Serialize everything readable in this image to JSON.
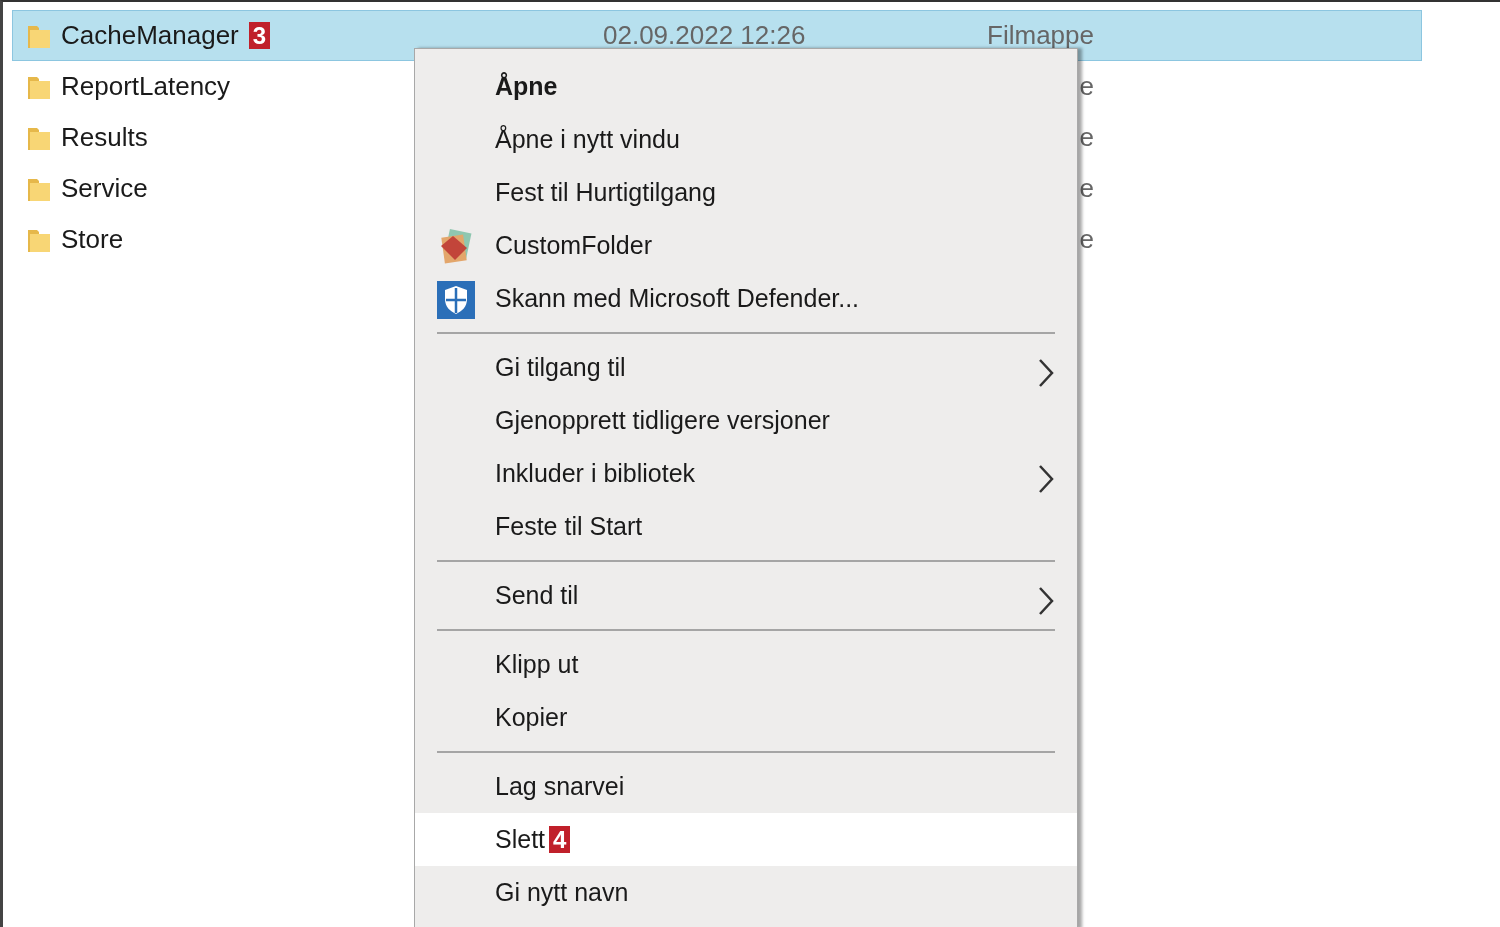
{
  "files": [
    {
      "name": "CacheManager",
      "badge": "3",
      "date": "02.09.2022 12:26",
      "type": "Filmappe",
      "selected": true
    },
    {
      "name": "ReportLatency",
      "type": "e",
      "selected": false
    },
    {
      "name": "Results",
      "type": "e",
      "selected": false
    },
    {
      "name": "Service",
      "type": "e",
      "selected": false
    },
    {
      "name": "Store",
      "type": "e",
      "selected": false
    }
  ],
  "context_menu": [
    {
      "kind": "item",
      "label": "Åpne",
      "bold": true,
      "selected": false
    },
    {
      "kind": "item",
      "label": "Åpne i nytt vindu",
      "selected": false
    },
    {
      "kind": "item",
      "label": "Fest til Hurtigtilgang",
      "selected": false
    },
    {
      "kind": "icon_item",
      "label": "CustomFolder",
      "selected": false
    },
    {
      "kind": "icon_item",
      "label": "Skann med Microsoft Defender...",
      "selected": false
    },
    {
      "kind": "separator"
    },
    {
      "kind": "item",
      "label": "Gi tilgang til",
      "submenu": true,
      "selected": false
    },
    {
      "kind": "item",
      "label": "Gjenopprett tidligere versjoner",
      "selected": false
    },
    {
      "kind": "item",
      "label": "Inkluder i bibliotek",
      "submenu": true,
      "selected": false
    },
    {
      "kind": "item",
      "label": "Feste til Start",
      "selected": false
    },
    {
      "kind": "separator"
    },
    {
      "kind": "item",
      "label": "Send til",
      "submenu": true,
      "selected": false
    },
    {
      "kind": "separator"
    },
    {
      "kind": "item",
      "label": "Klipp ut",
      "selected": false
    },
    {
      "kind": "item",
      "label": "Kopier",
      "selected": false
    },
    {
      "kind": "separator"
    },
    {
      "kind": "item",
      "label": "Lag snarvei",
      "selected": false
    },
    {
      "kind": "item",
      "label": "Slett",
      "badge": "4",
      "selected": true
    },
    {
      "kind": "item",
      "label": "Gi nytt navn",
      "selected": false
    }
  ]
}
